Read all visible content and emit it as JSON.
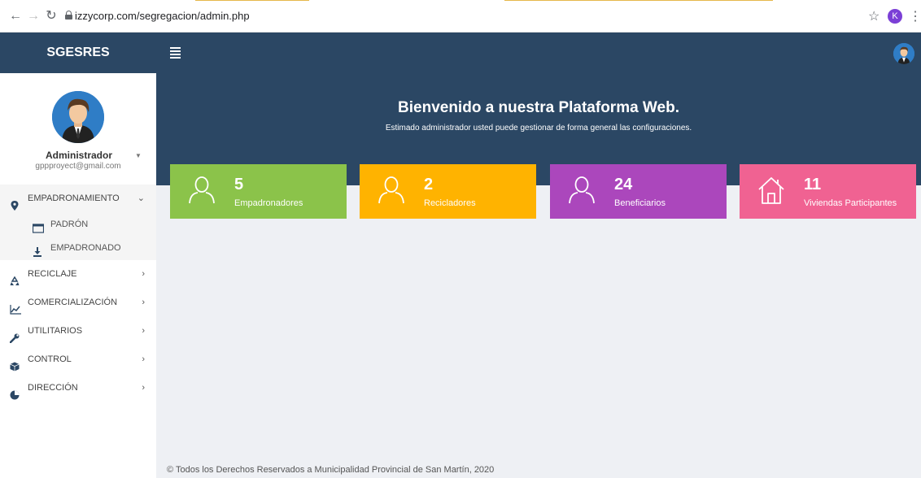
{
  "browser": {
    "url": "izzycorp.com/segregacion/admin.php",
    "profile_initial": "K"
  },
  "app": {
    "brand": "SGESRES"
  },
  "user": {
    "name": "Administrador",
    "email": "gppproyect@gmail.com"
  },
  "sidebar": {
    "groups": [
      {
        "label": "EMPADRONAMIENTO",
        "icon": "map-marker-icon",
        "expanded": true,
        "children": [
          {
            "label": "PADRÓN",
            "icon": "window-icon"
          },
          {
            "label": "EMPADRONADO",
            "icon": "download-icon"
          }
        ]
      },
      {
        "label": "RECICLAJE",
        "icon": "recycle-icon"
      },
      {
        "label": "COMERCIALIZACIÓN",
        "icon": "line-chart-icon"
      },
      {
        "label": "UTILITARIOS",
        "icon": "wrench-icon"
      },
      {
        "label": "CONTROL",
        "icon": "cube-icon"
      },
      {
        "label": "DIRECCIÓN",
        "icon": "pie-chart-icon"
      }
    ]
  },
  "banner": {
    "title": "Bienvenido a nuestra Plataforma Web.",
    "subtitle": "Estimado administrador usted puede gestionar de forma general las configuraciones."
  },
  "cards": [
    {
      "value": "5",
      "label": "Empadronadores",
      "color": "#8bc34a",
      "icon": "user-outline-icon"
    },
    {
      "value": "2",
      "label": "Recicladores",
      "color": "#ffb300",
      "icon": "user-outline-icon"
    },
    {
      "value": "24",
      "label": "Beneficiarios",
      "color": "#ab47bc",
      "icon": "user-outline-icon"
    },
    {
      "value": "11",
      "label": "Viviendas Participantes",
      "color": "#f06292",
      "icon": "home-outline-icon"
    }
  ],
  "footer": {
    "text": "© Todos los Derechos Reservados a Municipalidad Provincial de San Martín, 2020"
  },
  "colors": {
    "header": "#2b4764",
    "background": "#eef0f4"
  }
}
